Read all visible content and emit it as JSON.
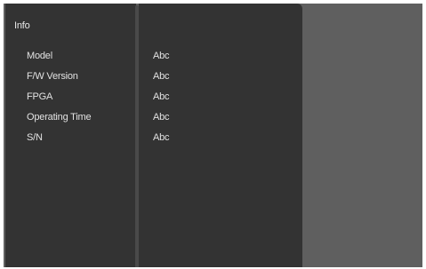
{
  "info": {
    "title": "Info",
    "rows": [
      {
        "label": "Model",
        "value": "Abc"
      },
      {
        "label": "F/W Version",
        "value": "Abc"
      },
      {
        "label": "FPGA",
        "value": "Abc"
      },
      {
        "label": "Operating Time",
        "value": "Abc"
      },
      {
        "label": "S/N",
        "value": "Abc"
      }
    ]
  },
  "colors": {
    "background": "#5f5f5f",
    "panel": "#333333",
    "text": "#e2e2e2"
  }
}
